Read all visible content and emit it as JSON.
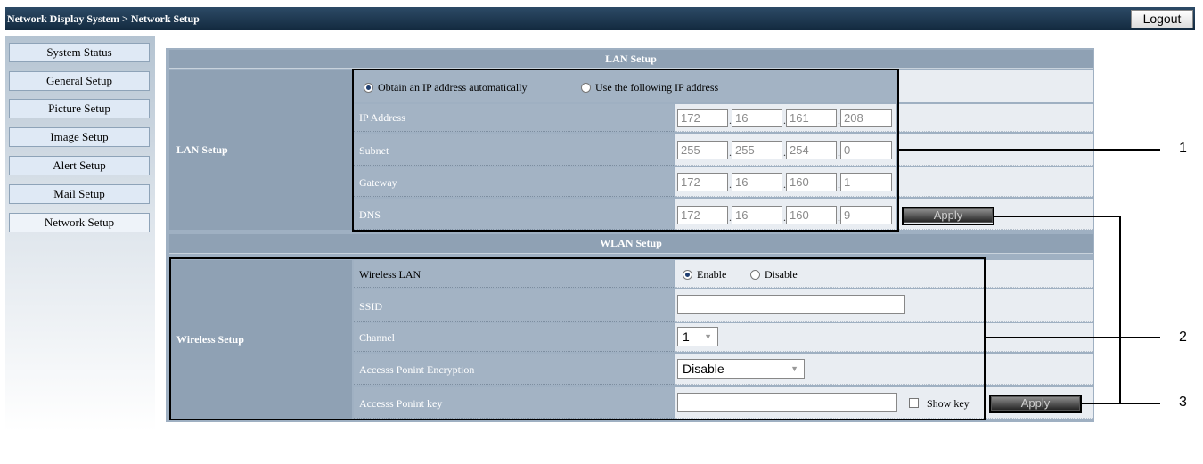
{
  "header": {
    "breadcrumb": "Network Display System > Network Setup",
    "logout_label": "Logout"
  },
  "sidebar": {
    "items": [
      {
        "label": "System Status"
      },
      {
        "label": "General Setup"
      },
      {
        "label": "Picture Setup"
      },
      {
        "label": "Image Setup"
      },
      {
        "label": "Alert Setup"
      },
      {
        "label": "Mail Setup"
      },
      {
        "label": "Network Setup",
        "active": true
      }
    ]
  },
  "lan": {
    "section_title": "LAN Setup",
    "group_label": "LAN Setup",
    "radio_auto": "Obtain an IP address automatically",
    "radio_manual": "Use the following IP address",
    "ip_label": "IP Address",
    "ip": [
      "172",
      "16",
      "161",
      "208"
    ],
    "subnet_label": "Subnet",
    "subnet": [
      "255",
      "255",
      "254",
      "0"
    ],
    "gateway_label": "Gateway",
    "gateway": [
      "172",
      "16",
      "160",
      "1"
    ],
    "dns_label": "DNS",
    "dns": [
      "172",
      "16",
      "160",
      "9"
    ],
    "apply_label": "Apply"
  },
  "wlan": {
    "section_title": "WLAN Setup",
    "group_label": "Wireless Setup",
    "wireless_lan_label": "Wireless LAN",
    "enable_label": "Enable",
    "disable_label": "Disable",
    "ssid_label": "SSID",
    "ssid_value": "",
    "channel_label": "Channel",
    "channel_value": "1",
    "encryption_label": "Accesss Ponint Encryption",
    "encryption_value": "Disable",
    "key_label": "Accesss Ponint key",
    "key_value": "",
    "show_key_label": "Show key",
    "apply_label": "Apply"
  },
  "callouts": [
    "1",
    "2",
    "3"
  ]
}
